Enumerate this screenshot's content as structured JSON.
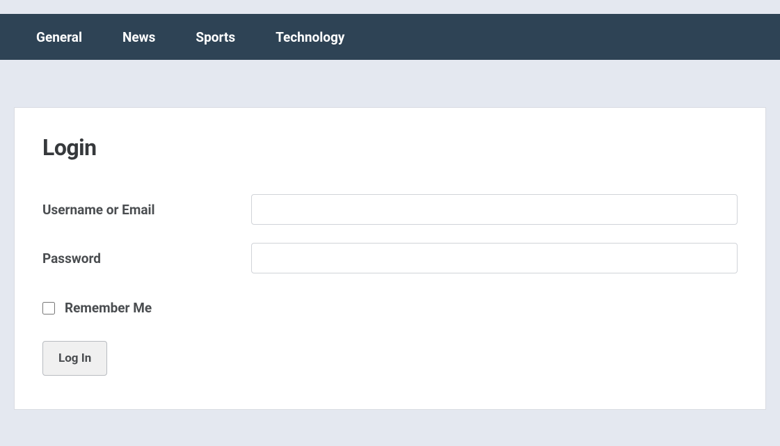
{
  "navbar": {
    "items": [
      {
        "label": "General"
      },
      {
        "label": "News"
      },
      {
        "label": "Sports"
      },
      {
        "label": "Technology"
      }
    ]
  },
  "login": {
    "title": "Login",
    "username_label": "Username or Email",
    "username_value": "",
    "password_label": "Password",
    "password_value": "",
    "remember_label": "Remember Me",
    "submit_label": "Log In"
  }
}
